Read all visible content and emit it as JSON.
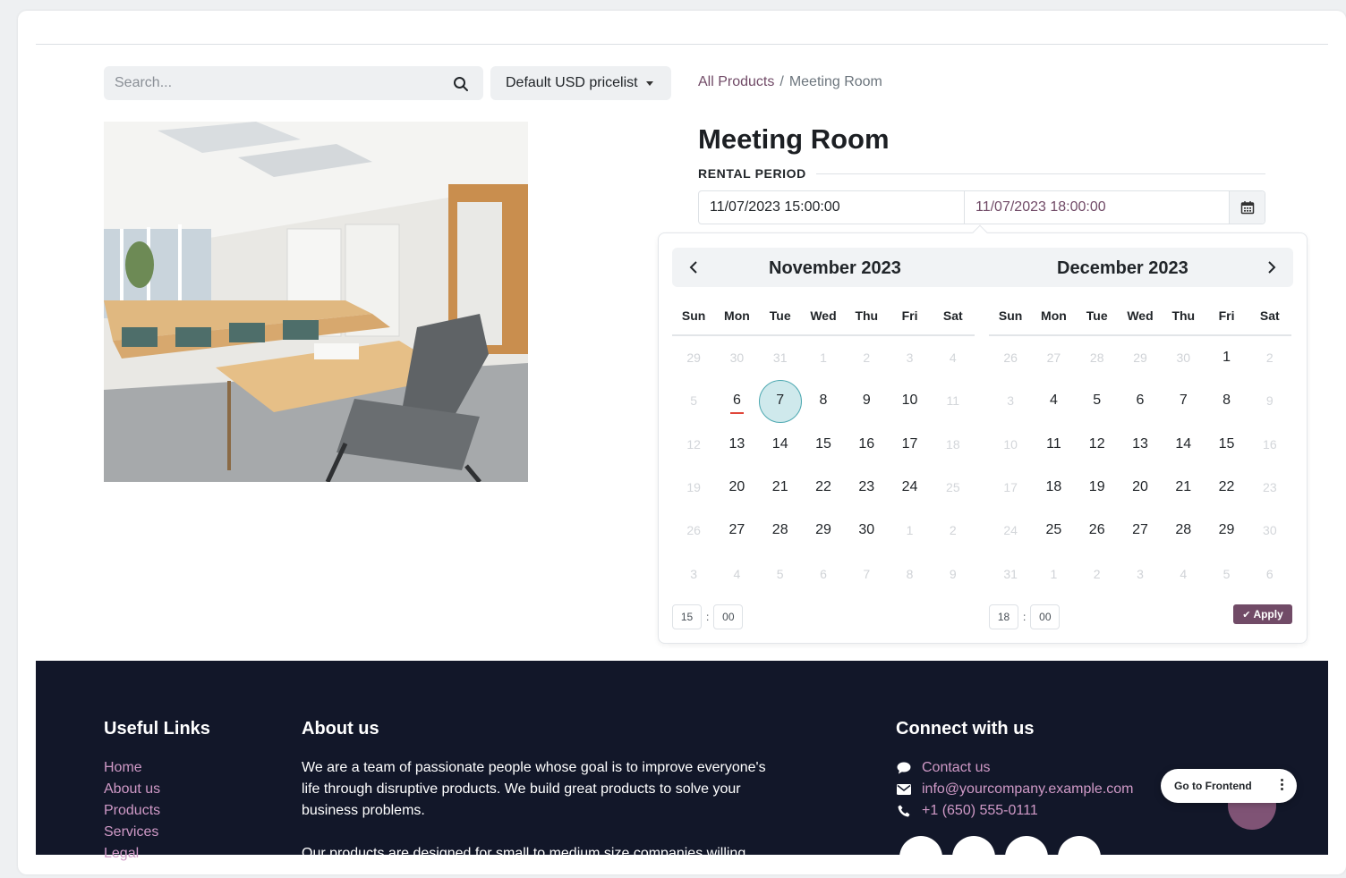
{
  "search": {
    "placeholder": "Search..."
  },
  "pricelist": {
    "label": "Default USD pricelist"
  },
  "breadcrumb": {
    "link": "All Products",
    "separator": "/",
    "current": "Meeting Room"
  },
  "product": {
    "title": "Meeting Room",
    "rental_label": "RENTAL PERIOD",
    "start_value": "11/07/2023 15:00:00",
    "end_value": "11/07/2023 18:00:00"
  },
  "picker": {
    "left_month": "November 2023",
    "right_month": "December 2023",
    "weekdays": [
      "Sun",
      "Mon",
      "Tue",
      "Wed",
      "Thu",
      "Fri",
      "Sat"
    ],
    "left_weeks": [
      [
        "29",
        "30",
        "31",
        "1",
        "2",
        "3",
        "4"
      ],
      [
        "5",
        "6",
        "7",
        "8",
        "9",
        "10",
        "11"
      ],
      [
        "12",
        "13",
        "14",
        "15",
        "16",
        "17",
        "18"
      ],
      [
        "19",
        "20",
        "21",
        "22",
        "23",
        "24",
        "25"
      ],
      [
        "26",
        "27",
        "28",
        "29",
        "30",
        "1",
        "2"
      ],
      [
        "3",
        "4",
        "5",
        "6",
        "7",
        "8",
        "9"
      ]
    ],
    "right_weeks": [
      [
        "26",
        "27",
        "28",
        "29",
        "30",
        "1",
        "2"
      ],
      [
        "3",
        "4",
        "5",
        "6",
        "7",
        "8",
        "9"
      ],
      [
        "10",
        "11",
        "12",
        "13",
        "14",
        "15",
        "16"
      ],
      [
        "17",
        "18",
        "19",
        "20",
        "21",
        "22",
        "23"
      ],
      [
        "24",
        "25",
        "26",
        "27",
        "28",
        "29",
        "30"
      ],
      [
        "31",
        "1",
        "2",
        "3",
        "4",
        "5",
        "6"
      ]
    ],
    "selected_day": "7",
    "today_day": "6",
    "start_hour": "15",
    "start_minute": "00",
    "end_hour": "18",
    "end_minute": "00",
    "apply_label": "Apply"
  },
  "footer": {
    "links_heading": "Useful Links",
    "links": [
      "Home",
      "About us",
      "Products",
      "Services",
      "Legal"
    ],
    "about_heading": "About us",
    "about_text_1": "We are a team of passionate people whose goal is to improve everyone's life through disruptive products. We build great products to solve your business problems.",
    "about_text_2": "Our products are designed for small to medium size companies willing",
    "connect_heading": "Connect with us",
    "contact_us": "Contact us",
    "email": "info@yourcompany.example.com",
    "phone": "+1 (650) 555-0111"
  },
  "frontend_button": {
    "label": "Go to Frontend"
  },
  "colors": {
    "accent": "#714b67",
    "footer_bg": "#121729",
    "selected_fill": "#cfe9ec",
    "selected_ring": "#4da8b1",
    "today_mark": "#e0463a",
    "footer_link": "#cf99c6"
  },
  "icons": [
    "search-icon",
    "caret-down-icon",
    "calendar-icon",
    "chevron-left-icon",
    "chevron-right-icon",
    "check-icon",
    "comment-icon",
    "envelope-icon",
    "phone-icon",
    "kebab-menu-icon"
  ]
}
